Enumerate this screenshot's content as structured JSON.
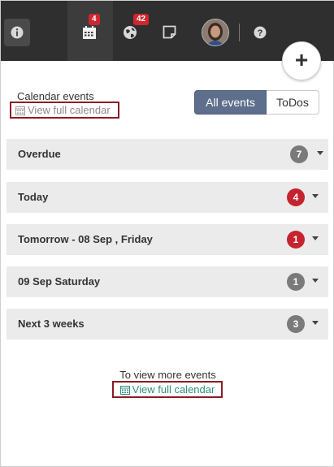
{
  "topbar": {
    "calendar_badge": "4",
    "notifications_badge": "42",
    "icons": [
      "info-icon",
      "calendar-icon",
      "globe-icon",
      "note-icon",
      "avatar",
      "help-icon"
    ]
  },
  "add_button": {
    "label": "+"
  },
  "header": {
    "title": "Calendar events",
    "view_full_calendar": "View full calendar"
  },
  "filter": {
    "all_events": "All events",
    "todos": "ToDos"
  },
  "sections": [
    {
      "label": "Overdue",
      "count": "7",
      "badge_color": "#7a7a7a"
    },
    {
      "label": "Today",
      "count": "4",
      "badge_color": "#c5232e"
    },
    {
      "label": "Tomorrow - 08 Sep , Friday",
      "count": "1",
      "badge_color": "#c5232e"
    },
    {
      "label": "09 Sep Saturday",
      "count": "1",
      "badge_color": "#7a7a7a"
    },
    {
      "label": "Next 3 weeks",
      "count": "3",
      "badge_color": "#7a7a7a"
    }
  ],
  "footer": {
    "more_text": "To view more events",
    "view_full_calendar": "View full calendar"
  },
  "colors": {
    "accent_link": "#2f8f7a",
    "highlight_border": "#8b1c24",
    "segmented_active": "#5d6f8c"
  }
}
